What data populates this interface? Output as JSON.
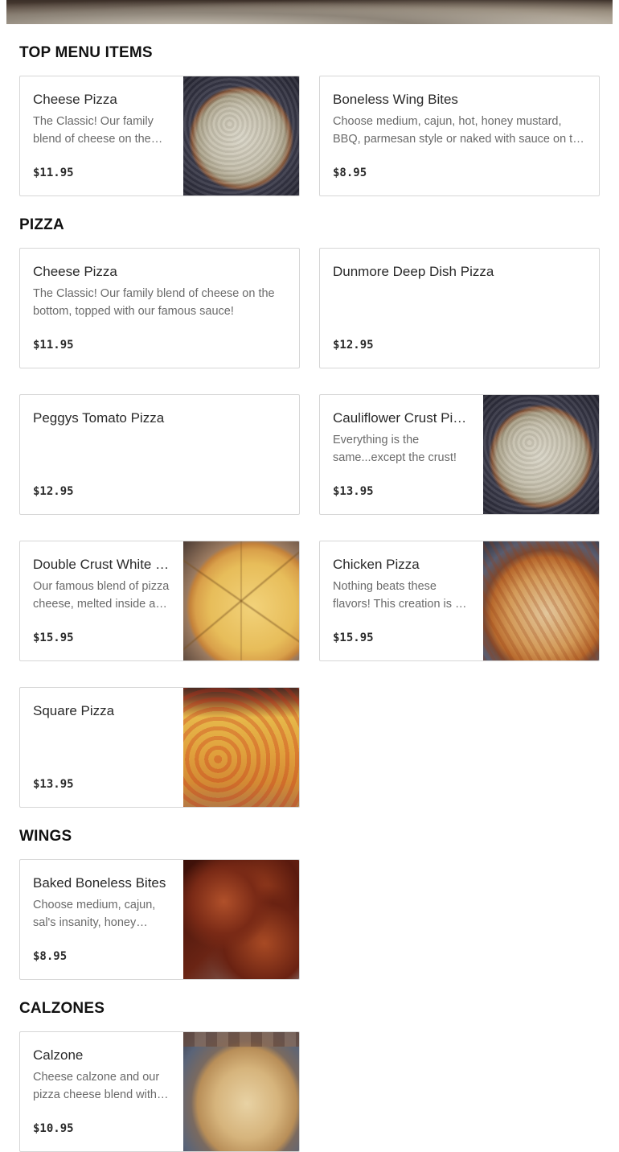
{
  "sections": [
    {
      "title": "TOP MENU ITEMS",
      "items": [
        {
          "name": "Cheese Pizza",
          "description": "The Classic! Our family blend of cheese on the bottom, topped with our famous sauce!",
          "price": "$11.95",
          "image": "cheese-pizza-photo"
        },
        {
          "name": "Boneless Wing Bites",
          "description": "Choose medium, cajun, hot, honey mustard, BBQ, parmesan style or naked with sauce on the side.",
          "price": "$8.95"
        }
      ]
    },
    {
      "title": "PIZZA",
      "items": [
        {
          "name": "Cheese Pizza",
          "description": "The Classic! Our family blend of cheese on the bottom, topped with our famous sauce!",
          "price": "$11.95"
        },
        {
          "name": "Dunmore Deep Dish Pizza",
          "description": "",
          "price": "$12.95"
        },
        {
          "name": "Peggys Tomato Pizza",
          "description": "",
          "price": "$12.95"
        },
        {
          "name": "Cauliflower Crust Pizza",
          "description": "Everything is the same...except the crust!",
          "price": "$13.95",
          "image": "cauliflower-pizza-photo"
        },
        {
          "name": "Double Crust White Pizza",
          "description": "Our famous blend of pizza cheese, melted inside a double crust.",
          "price": "$15.95",
          "image": "white-pizza-photo"
        },
        {
          "name": "Chicken Pizza",
          "description": "Nothing beats these flavors! This creation is a customer favorite.",
          "price": "$15.95",
          "image": "chicken-pizza-photo"
        },
        {
          "name": "Square Pizza",
          "description": "",
          "price": "$13.95",
          "image": "square-pizza-photo"
        }
      ]
    },
    {
      "title": "WINGS",
      "items": [
        {
          "name": "Baked Boneless Bites",
          "description": "Choose medium, cajun, sal's insanity, honey mustard, BBQ or parmesan style.",
          "price": "$8.95",
          "image": "wings-photo"
        }
      ]
    },
    {
      "title": "CALZONES",
      "items": [
        {
          "name": "Calzone",
          "description": "Cheese calzone and our pizza cheese blend with ricotta inside.",
          "price": "$10.95",
          "image": "calzone-photo"
        }
      ]
    }
  ]
}
